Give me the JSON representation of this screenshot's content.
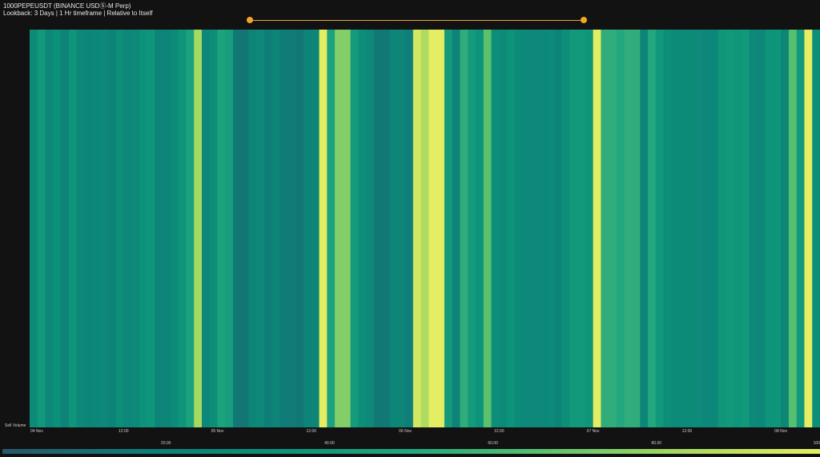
{
  "header": {
    "title": "1000PEPEUSDT (BINANCE USDⓈ-M Perp)",
    "subtitle": "Lookback: 3 Days | 1 Hr timeframe | Relative to Itself"
  },
  "range_slider": {
    "start": 0.0,
    "end": 1.0
  },
  "colors": {
    "background": "#121212",
    "slider": "#f5a623",
    "colorscale": [
      "#2a5768",
      "#0f7c78",
      "#0b9279",
      "#23a77f",
      "#5dc26e",
      "#a8d962",
      "#e5ee62"
    ]
  },
  "chart_data": {
    "type": "heatmap",
    "title": "",
    "xlabel": "",
    "ylabel": "Sell Volume",
    "y_categories": [
      "Sell Volume"
    ],
    "x_ticks": [
      "04 Nov",
      "12:00",
      "05 Nov",
      "12:00",
      "06 Nov",
      "12:00",
      "07 Nov",
      "12:00",
      "08 Nov"
    ],
    "colorbar": {
      "min": 0,
      "max": 100,
      "ticks": [
        "20.00",
        "40.00",
        "60.00",
        "80.00",
        "100"
      ]
    },
    "values": [
      28,
      38,
      25,
      32,
      22,
      36,
      26,
      24,
      25,
      26,
      22,
      30,
      25,
      26,
      34,
      36,
      23,
      24,
      28,
      36,
      45,
      83,
      25,
      30,
      46,
      42,
      15,
      14,
      24,
      26,
      18,
      22,
      17,
      16,
      15,
      22,
      24,
      100,
      46,
      75,
      75,
      40,
      30,
      26,
      15,
      15,
      24,
      24,
      18,
      95,
      85,
      100,
      100,
      40,
      22,
      54,
      40,
      34,
      66,
      30,
      28,
      34,
      28,
      26,
      26,
      26,
      28,
      23,
      30,
      38,
      38,
      36,
      100,
      54,
      54,
      50,
      54,
      54,
      24,
      50,
      38,
      30,
      28,
      27,
      28,
      27,
      25,
      25,
      37,
      38,
      36,
      38,
      26,
      25,
      35,
      36,
      24,
      65,
      38,
      100,
      30
    ]
  }
}
